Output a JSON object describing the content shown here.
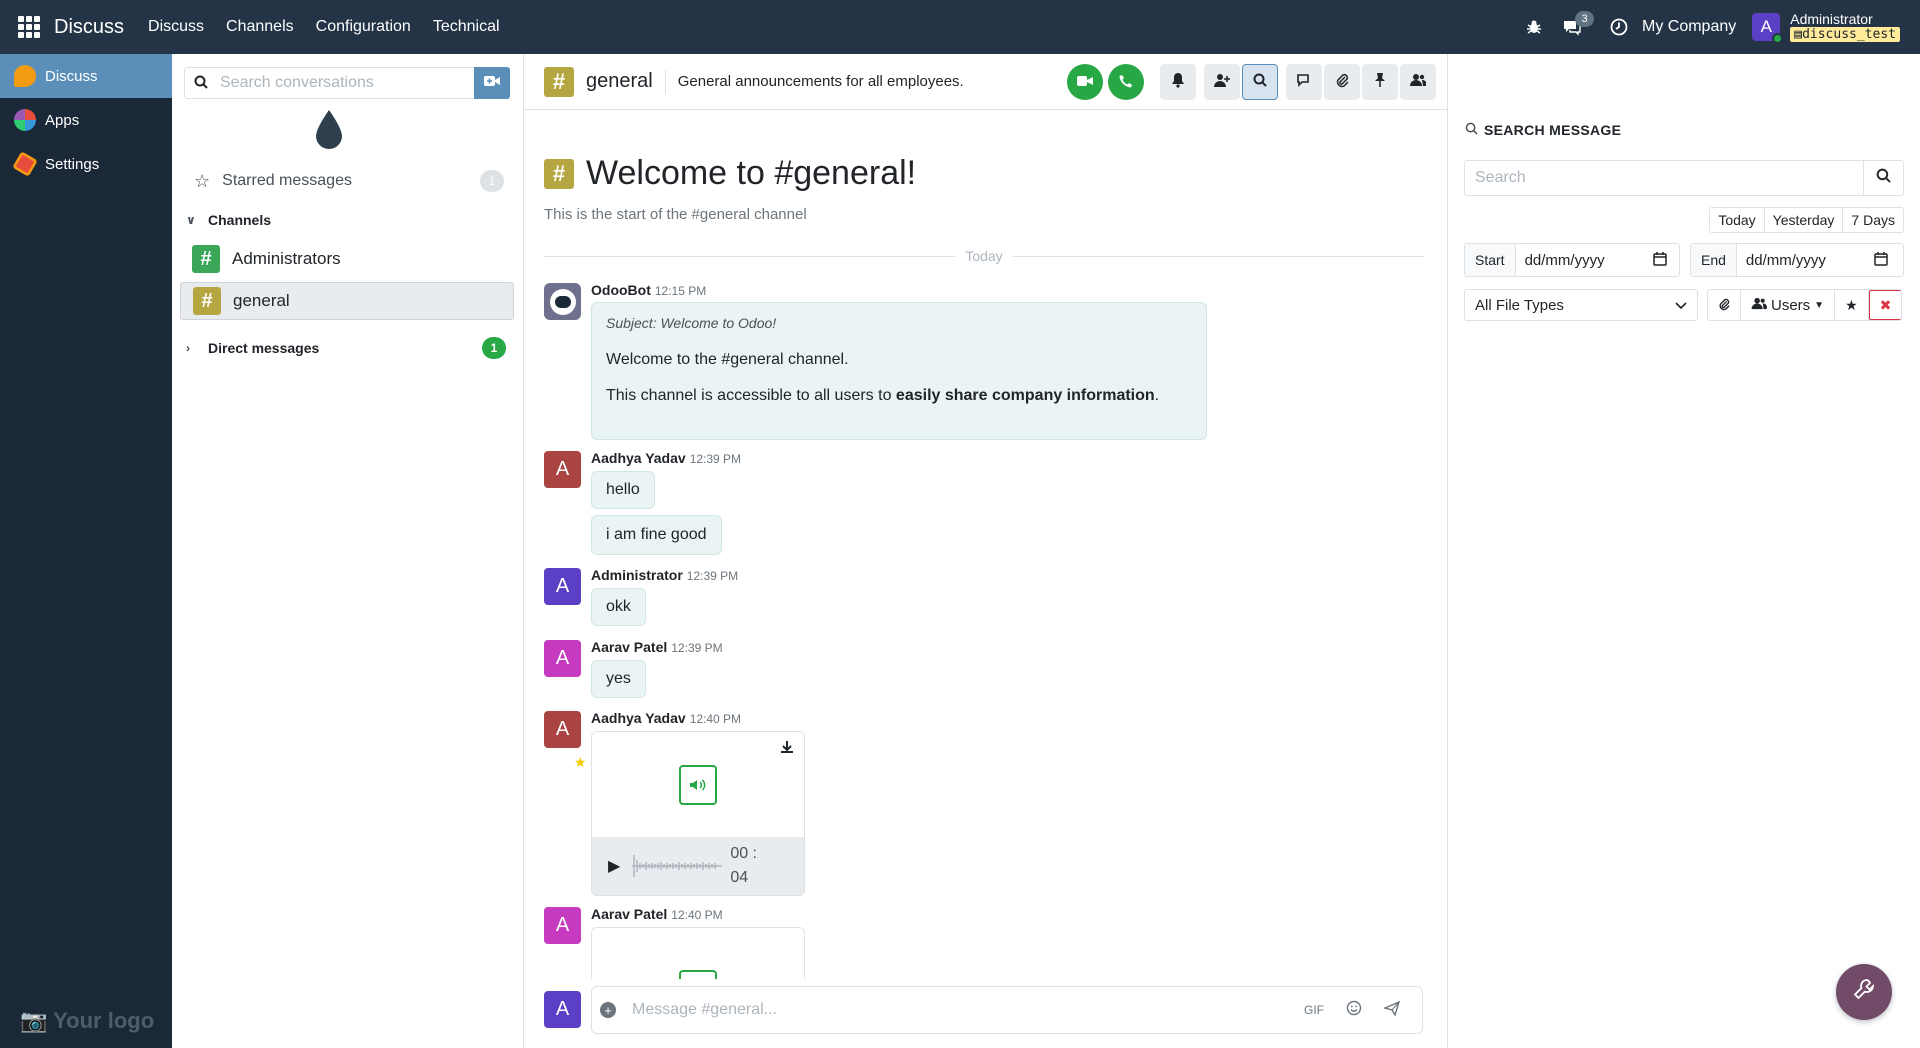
{
  "topbar": {
    "app_name": "Discuss",
    "menu": [
      "Discuss",
      "Channels",
      "Configuration",
      "Technical"
    ],
    "chat_count": "3",
    "company": "My Company",
    "user_initial": "A",
    "user_name": "Administrator",
    "database": "discuss_test"
  },
  "sidebar": {
    "items": [
      {
        "label": "Discuss",
        "icon": "discuss-icon",
        "color": "#f39c12"
      },
      {
        "label": "Apps",
        "icon": "apps-icon",
        "color": "#e74c3c"
      },
      {
        "label": "Settings",
        "icon": "settings-icon",
        "color": "#e74c3c"
      }
    ],
    "logo_text": "Your logo"
  },
  "convlist": {
    "search_placeholder": "Search conversations",
    "starred_label": "Starred messages",
    "starred_count": "1",
    "channels_label": "Channels",
    "channels": [
      {
        "name": "Administrators",
        "color": "#3aa657"
      },
      {
        "name": "general",
        "color": "#b5a642"
      }
    ],
    "direct_label": "Direct messages",
    "direct_count": "1"
  },
  "chat": {
    "channel_name": "general",
    "channel_description": "General announcements for all employees.",
    "welcome_title": "Welcome to #general!",
    "welcome_subtitle": "This is the start of the #general channel",
    "date_separator": "Today",
    "messages": {
      "bot": {
        "author": "OdooBot",
        "time": "12:15 PM",
        "subject": "Subject: Welcome to Odoo!",
        "line1": "Welcome to the #general channel.",
        "line2_prefix": "This channel is accessible to all users to ",
        "line2_bold": "easily share company information",
        "line2_suffix": "."
      },
      "m1": {
        "initial": "A",
        "author": "Aadhya Yadav",
        "time": "12:39 PM",
        "texts": [
          "hello",
          "i am fine good"
        ],
        "color": "#a94442"
      },
      "m2": {
        "initial": "A",
        "author": "Administrator",
        "time": "12:39 PM",
        "text": "okk",
        "color": "#5b3fc4"
      },
      "m3": {
        "initial": "A",
        "author": "Aarav Patel",
        "time": "12:39 PM",
        "text": "yes",
        "color": "#c53abf"
      },
      "m4": {
        "initial": "A",
        "author": "Aadhya Yadav",
        "time": "12:40 PM",
        "duration_line1": "00 :",
        "duration_line2": "04",
        "color": "#a94442"
      },
      "m5": {
        "initial": "A",
        "author": "Aarav Patel",
        "time": "12:40 PM",
        "color": "#c53abf"
      }
    },
    "composer_placeholder": "Message #general...",
    "composer_initial": "A",
    "gif_label": "GIF"
  },
  "search_panel": {
    "title": "SEARCH MESSAGE",
    "search_placeholder": "Search",
    "quick_filters": [
      "Today",
      "Yesterday",
      "7 Days"
    ],
    "start_label": "Start",
    "start_value": "dd/mm/yyyy",
    "end_label": "End",
    "end_value": "dd/mm/yyyy",
    "file_type": "All File Types",
    "users_label": "Users"
  }
}
